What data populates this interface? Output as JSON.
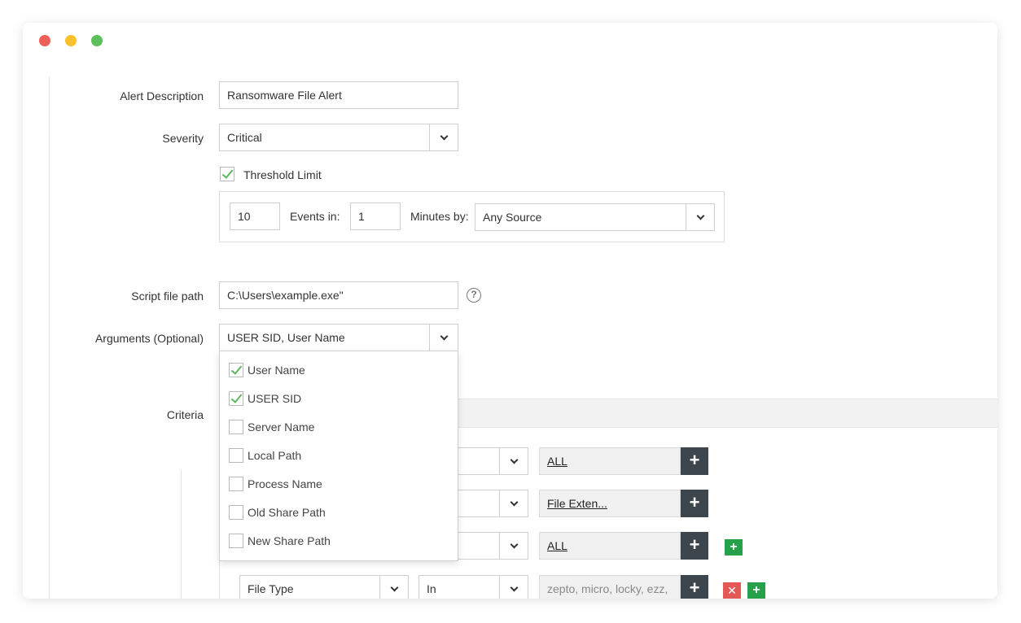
{
  "window": {
    "controls": [
      "close",
      "minimize",
      "maximize"
    ]
  },
  "form": {
    "alert_description": {
      "label": "Alert Description",
      "value": "Ransomware File Alert"
    },
    "severity": {
      "label": "Severity",
      "value": "Critical"
    },
    "threshold": {
      "checkbox_label": "Threshold Limit",
      "checked": true,
      "events_value": "10",
      "events_label": "Events in:",
      "minutes_value": "1",
      "minutes_label": "Minutes by:",
      "source_value": "Any Source"
    },
    "script_path": {
      "label": "Script file path",
      "value": "C:\\Users\\example.exe\"",
      "help_icon": "?"
    },
    "arguments": {
      "label": "Arguments (Optional)",
      "value": "USER SID, User Name",
      "options": [
        {
          "label": "User Name",
          "checked": true
        },
        {
          "label": "USER SID",
          "checked": true
        },
        {
          "label": "Server Name",
          "checked": false
        },
        {
          "label": "Local Path",
          "checked": false
        },
        {
          "label": "Process Name",
          "checked": false
        },
        {
          "label": "Old Share Path",
          "checked": false
        },
        {
          "label": "New Share Path",
          "checked": false
        }
      ]
    },
    "criteria": {
      "label": "Criteria",
      "rows": [
        {
          "value_text": "ALL",
          "plus": "+"
        },
        {
          "value_text": "File Exten...",
          "plus": "+"
        },
        {
          "value_text": "ALL",
          "plus": "+",
          "add": "+"
        },
        {
          "field": "File Type",
          "operator": "In",
          "value_placeholder": "zepto, micro, locky, ezz,",
          "plus": "+",
          "remove": "✕",
          "add": "+"
        }
      ]
    }
  },
  "colors": {
    "check_green": "#5cb85c",
    "dark_button": "#3d464d",
    "add_green": "#27a04a",
    "remove_red": "#e45757"
  }
}
